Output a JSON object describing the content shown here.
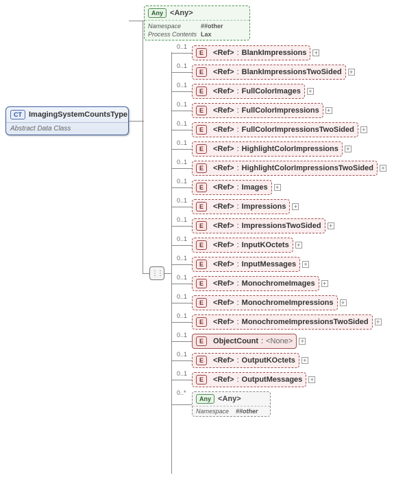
{
  "root": {
    "badge": "CT",
    "title": "ImagingSystemCountsType",
    "subtitle": "Abstract Data Class"
  },
  "any_top": {
    "badge": "Any",
    "title": "<Any>",
    "meta": {
      "namespace_label": "Namespace",
      "namespace_value": "##other",
      "process_label": "Process Contents",
      "process_value": "Lax"
    }
  },
  "children": [
    {
      "card": "0..1",
      "ref": "<Ref>",
      "name": "BlankImpressions"
    },
    {
      "card": "0..1",
      "ref": "<Ref>",
      "name": "BlankImpressionsTwoSided"
    },
    {
      "card": "0..1",
      "ref": "<Ref>",
      "name": "FullColorImages"
    },
    {
      "card": "0..1",
      "ref": "<Ref>",
      "name": "FullColorImpressions"
    },
    {
      "card": "0..1",
      "ref": "<Ref>",
      "name": "FullColorImpressionsTwoSided"
    },
    {
      "card": "0..1",
      "ref": "<Ref>",
      "name": "HighlightColorImpressions"
    },
    {
      "card": "0..1",
      "ref": "<Ref>",
      "name": "HighlightColorImpressionsTwoSided"
    },
    {
      "card": "0..1",
      "ref": "<Ref>",
      "name": "Images"
    },
    {
      "card": "0..1",
      "ref": "<Ref>",
      "name": "Impressions"
    },
    {
      "card": "0..1",
      "ref": "<Ref>",
      "name": "ImpressionsTwoSided"
    },
    {
      "card": "0..1",
      "ref": "<Ref>",
      "name": "InputKOctets"
    },
    {
      "card": "0..1",
      "ref": "<Ref>",
      "name": "InputMessages"
    },
    {
      "card": "0..1",
      "ref": "<Ref>",
      "name": "MonochromeImages"
    },
    {
      "card": "0..1",
      "ref": "<Ref>",
      "name": "MonochromeImpressions"
    },
    {
      "card": "0..1",
      "ref": "<Ref>",
      "name": "MonochromeImpressionsTwoSided"
    },
    {
      "card": "0..1",
      "label": "ObjectCount",
      "value": "<None>",
      "solid": true,
      "noRef": true
    },
    {
      "card": "0..1",
      "ref": "<Ref>",
      "name": "OutputKOctets"
    },
    {
      "card": "0..1",
      "ref": "<Ref>",
      "name": "OutputMessages"
    }
  ],
  "any_bottom": {
    "card": "0..*",
    "badge": "Any",
    "title": "<Any>",
    "namespace_label": "Namespace",
    "namespace_value": "##other"
  },
  "badges": {
    "E": "E"
  }
}
